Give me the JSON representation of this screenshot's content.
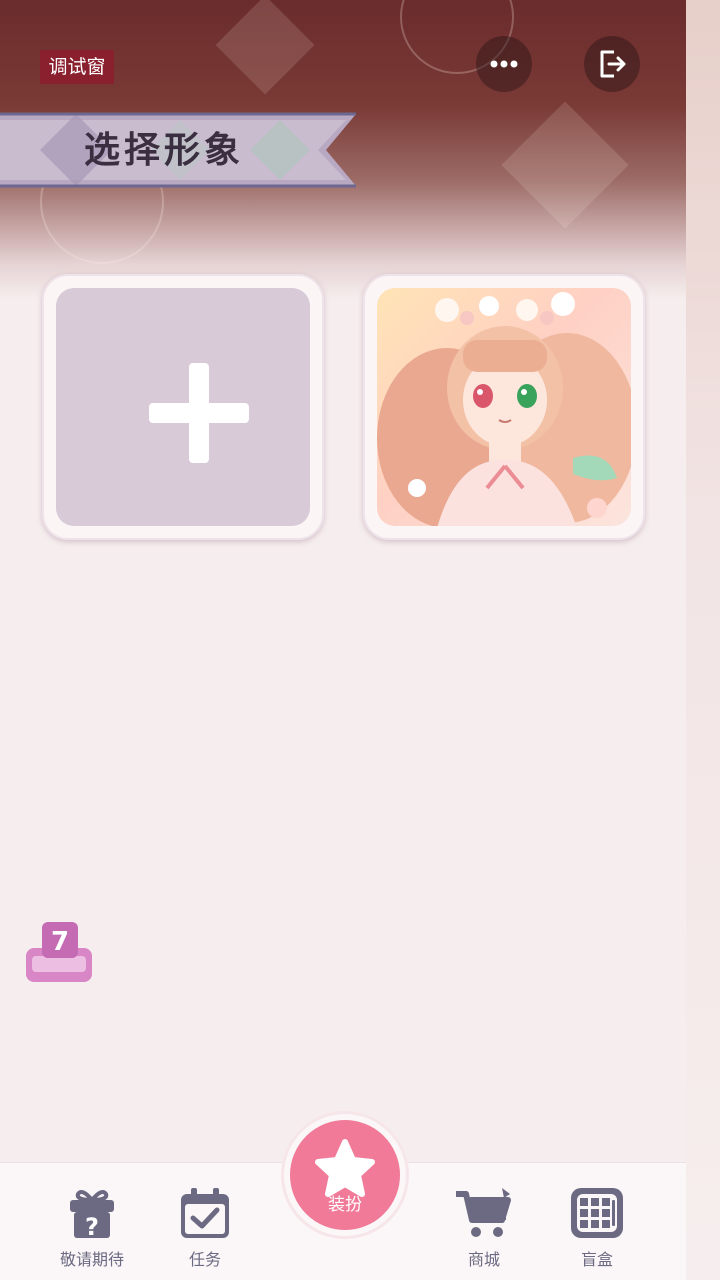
{
  "debug_label": "调试窗",
  "header": {
    "title": "选择形象",
    "more_icon": "more-dots-icon",
    "exit_icon": "exit-icon"
  },
  "cards": [
    {
      "type": "add",
      "icon": "plus-icon"
    },
    {
      "type": "avatar",
      "icon": "anime-girl-avatar"
    }
  ],
  "side_badge": {
    "count": "7"
  },
  "nav": {
    "items": [
      {
        "label": "敬请期待",
        "icon": "gift-question-icon"
      },
      {
        "label": "任务",
        "icon": "calendar-check-icon"
      },
      {
        "label": "装扮",
        "icon": "star-icon"
      },
      {
        "label": "商城",
        "icon": "cart-icon"
      },
      {
        "label": "盲盒",
        "icon": "box-grid-icon"
      }
    ]
  },
  "colors": {
    "accent": "#f07a98",
    "debug_bg": "#8a1f2d",
    "nav_icon": "#6c6a82",
    "card_add_bg": "#d8cbd7"
  }
}
